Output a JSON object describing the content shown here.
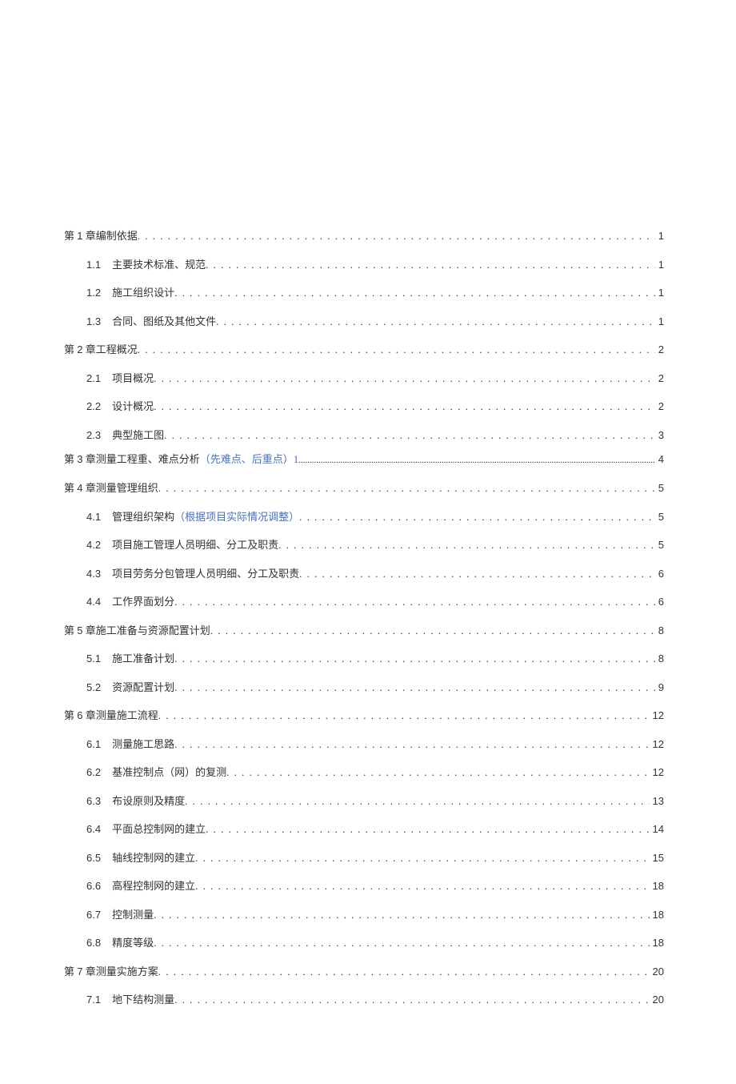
{
  "toc": [
    {
      "level": 1,
      "label": "第 1 章编制依据",
      "page": "1"
    },
    {
      "level": 2,
      "num": "1.1",
      "title": "主要技术标准、规范",
      "page": "1"
    },
    {
      "level": 2,
      "num": "1.2",
      "title": "施工组织设计",
      "page": "1"
    },
    {
      "level": 2,
      "num": "1.3",
      "title": "合同、图纸及其他文件",
      "page": "1"
    },
    {
      "level": 1,
      "label": "第 2 章工程概况",
      "page": "2"
    },
    {
      "level": 2,
      "num": "2.1",
      "title": "项目概况",
      "page": "2"
    },
    {
      "level": 2,
      "num": "2.2",
      "title": "设计概况",
      "page": "2"
    },
    {
      "level": 2,
      "num": "2.3",
      "title": "典型施工图",
      "page": "3"
    },
    {
      "level": 1,
      "label": "第 3 章测量工程重、难点分析",
      "annot": "（先难点、后重点）1",
      "page": "4",
      "special": true
    },
    {
      "level": 1,
      "label": "第 4 章测量管理组织",
      "page": "5"
    },
    {
      "level": 2,
      "num": "4.1",
      "title": "管理组织架构",
      "annot": "（根据项目实际情况调整）",
      "page": "5"
    },
    {
      "level": 2,
      "num": "4.2",
      "title": "项目施工管理人员明细、分工及职责",
      "page": "5"
    },
    {
      "level": 2,
      "num": "4.3",
      "title": "项目劳务分包管理人员明细、分工及职责",
      "page": "6"
    },
    {
      "level": 2,
      "num": "4.4",
      "title": "工作界面划分",
      "page": "6"
    },
    {
      "level": 1,
      "label": "第 5 章施工准备与资源配置计划",
      "page": "8"
    },
    {
      "level": 2,
      "num": "5.1",
      "title": "施工准备计划",
      "page": "8"
    },
    {
      "level": 2,
      "num": "5.2",
      "title": "资源配置计划",
      "page": "9"
    },
    {
      "level": 1,
      "label": "第 6 章测量施工流程",
      "page": "12"
    },
    {
      "level": 2,
      "num": "6.1",
      "title": "测量施工思路",
      "page": "12"
    },
    {
      "level": 2,
      "num": "6.2",
      "title": "基准控制点（网）的复测",
      "page": "12"
    },
    {
      "level": 2,
      "num": "6.3",
      "title": "布设原则及精度",
      "page": "13"
    },
    {
      "level": 2,
      "num": "6.4",
      "title": "平面总控制网的建立",
      "page": "14"
    },
    {
      "level": 2,
      "num": "6.5",
      "title": "轴线控制网的建立",
      "page": "15"
    },
    {
      "level": 2,
      "num": "6.6",
      "title": "高程控制网的建立",
      "page": "18"
    },
    {
      "level": 2,
      "num": "6.7",
      "title": "控制测量",
      "page": "18"
    },
    {
      "level": 2,
      "num": "6.8",
      "title": "精度等级",
      "page": "18"
    },
    {
      "level": 1,
      "label": "第 7 章测量实施方案",
      "page": "20"
    },
    {
      "level": 2,
      "num": "7.1",
      "title": "地下结构测量",
      "page": "20"
    }
  ]
}
